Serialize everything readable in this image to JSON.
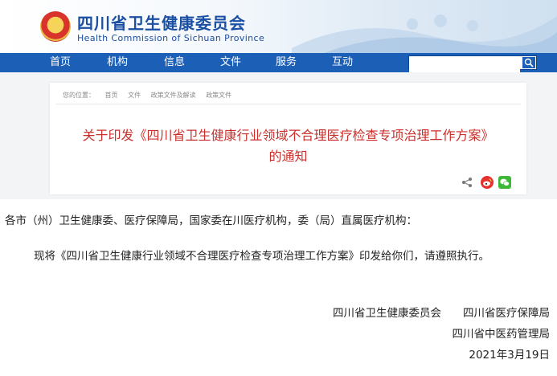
{
  "header": {
    "title": "四川省卫生健康委员会",
    "subtitle": "Health Commission of Sichuan Province"
  },
  "nav": {
    "items": [
      "首页",
      "机构",
      "信息",
      "文件",
      "服务",
      "互动"
    ],
    "search_placeholder": ""
  },
  "breadcrumb": [
    "您的位置：",
    "首页",
    "文件",
    "政策文件及解读",
    "政策文件"
  ],
  "article": {
    "title_line1": "关于印发《四川省卫生健康行业领域不合理医疗检查专项治理工作方案》",
    "title_line2": "的通知",
    "salutation": "各市（州）卫生健康委、医疗保障局，国家委在川医疗机构，委（局）直属医疗机构：",
    "paragraph": "现将《四川省卫生健康行业领域不合理医疗检查专项治理工作方案》印发给你们，请遵照执行。",
    "signature_line1": "四川省卫生健康委员会　　四川省医疗保障局",
    "signature_line2": "四川省中医药管理局",
    "date": "2021年3月19日"
  },
  "colors": {
    "nav_bg": "#1c5fb6",
    "title_red": "#c9302c",
    "brand_blue": "#1b4fa3"
  },
  "icons": [
    "emblem-icon",
    "search-icon",
    "share-icon",
    "weibo-icon",
    "wechat-icon"
  ]
}
